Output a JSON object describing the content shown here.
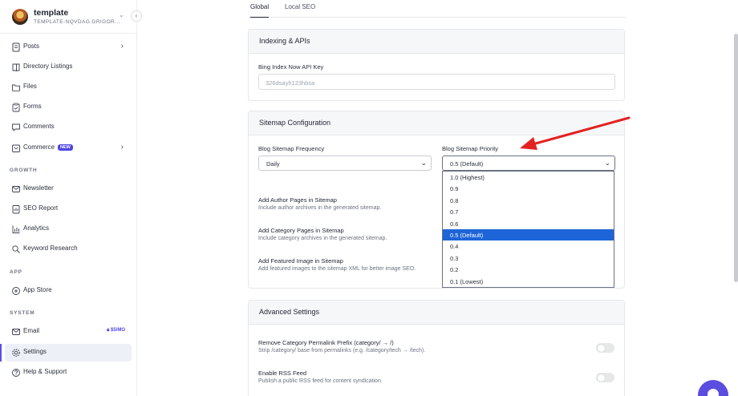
{
  "site": {
    "name": "template",
    "subtitle": "TEMPLATE-NQVDAG.GRIGOR..."
  },
  "sidebar": {
    "items_main": [
      {
        "label": "Posts",
        "icon": "document-icon"
      },
      {
        "label": "Directory Listings",
        "icon": "book-icon"
      },
      {
        "label": "Files",
        "icon": "folder-icon"
      },
      {
        "label": "Forms",
        "icon": "clipboard-icon"
      },
      {
        "label": "Comments",
        "icon": "comment-icon"
      },
      {
        "label": "Commerce",
        "icon": "cart-icon",
        "badge": "NEW"
      }
    ],
    "growth_label": "GROWTH",
    "items_growth": [
      {
        "label": "Newsletter",
        "icon": "mail-icon"
      },
      {
        "label": "SEO Report",
        "icon": "report-icon"
      },
      {
        "label": "Analytics",
        "icon": "chart-icon"
      },
      {
        "label": "Keyword Research",
        "icon": "search-icon"
      }
    ],
    "app_label": "APP",
    "items_app": [
      {
        "label": "App Store",
        "icon": "store-icon"
      }
    ],
    "system_label": "SYSTEM",
    "items_system": [
      {
        "label": "Email",
        "icon": "mail-icon",
        "price": "$5/MO"
      },
      {
        "label": "Settings",
        "icon": "gear-icon",
        "active": true
      },
      {
        "label": "Help & Support",
        "icon": "help-icon"
      }
    ]
  },
  "tabs": [
    {
      "label": "Global",
      "active": true
    },
    {
      "label": "Local SEO"
    }
  ],
  "indexing": {
    "title": "Indexing & APIs",
    "bing_label": "Bing Index Now API Key",
    "bing_value": "326dsayh123hbsa"
  },
  "sitemap": {
    "title": "Sitemap Configuration",
    "frequency_label": "Blog Sitemap Frequency",
    "frequency_value": "Daily",
    "priority_label": "Blog Sitemap Priority",
    "priority_value": "0.5 (Default)",
    "priority_options": [
      "1.0 (Highest)",
      "0.9",
      "0.8",
      "0.7",
      "0.6",
      "0.5 (Default)",
      "0.4",
      "0.3",
      "0.2",
      "0.1 (Lowest)"
    ],
    "priority_selected_index": 5,
    "rows": [
      {
        "title": "Add Author Pages in Sitemap",
        "desc": "Include author archives in the generated sitemap."
      },
      {
        "title": "Add Category Pages in Sitemap",
        "desc": "Include category archives in the generated sitemap."
      },
      {
        "title": "Add Featured Image in Sitemap",
        "desc": "Add featured images to the sitemap XML for better image SEO."
      }
    ]
  },
  "advanced": {
    "title": "Advanced Settings",
    "rows": [
      {
        "title": "Remove Category Permalink Prefix (category/ → /)",
        "desc": "Strip /category/ base from permalinks (e.g. /category/tech → /tech).",
        "enabled": false
      },
      {
        "title": "Enable RSS Feed",
        "desc": "Publish a public RSS feed for content syndication.",
        "enabled": false
      }
    ]
  },
  "colors": {
    "accent": "#5b4de0",
    "selected": "#1d64d8",
    "annotation_arrow": "#e32222"
  }
}
